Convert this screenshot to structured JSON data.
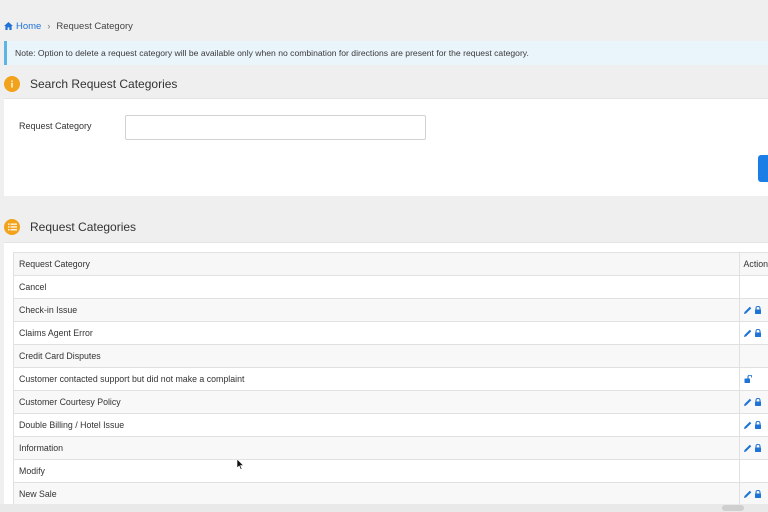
{
  "breadcrumb": {
    "home": "Home",
    "current": "Request Category"
  },
  "note": "Note: Option to delete a request category will be available only when no combination for directions are present for the request category.",
  "search_section": {
    "title": "Search Request Categories",
    "field_label": "Request Category",
    "field_value": "",
    "field_placeholder": ""
  },
  "list_section": {
    "title": "Request Categories",
    "columns": [
      "Request Category",
      "Action"
    ],
    "rows": [
      {
        "name": "Cancel",
        "actions": []
      },
      {
        "name": "Check-in Issue",
        "actions": [
          "edit-icon",
          "lock-icon"
        ]
      },
      {
        "name": "Claims Agent Error",
        "actions": [
          "edit-icon",
          "lock-icon"
        ]
      },
      {
        "name": "Credit Card Disputes",
        "actions": []
      },
      {
        "name": "Customer contacted support but did not make a complaint",
        "actions": [
          "unlock-icon"
        ]
      },
      {
        "name": "Customer Courtesy Policy",
        "actions": [
          "edit-icon",
          "lock-icon"
        ]
      },
      {
        "name": "Double Billing / Hotel Issue",
        "actions": [
          "edit-icon",
          "lock-icon"
        ]
      },
      {
        "name": "Information",
        "actions": [
          "edit-icon",
          "lock-icon"
        ]
      },
      {
        "name": "Modify",
        "actions": []
      },
      {
        "name": "New Sale",
        "actions": [
          "edit-icon",
          "lock-icon"
        ]
      }
    ]
  },
  "colors": {
    "accent": "#1f73d6",
    "badge": "#f2a21b",
    "note_border": "#5fb4e6",
    "button": "#1b7de6"
  }
}
